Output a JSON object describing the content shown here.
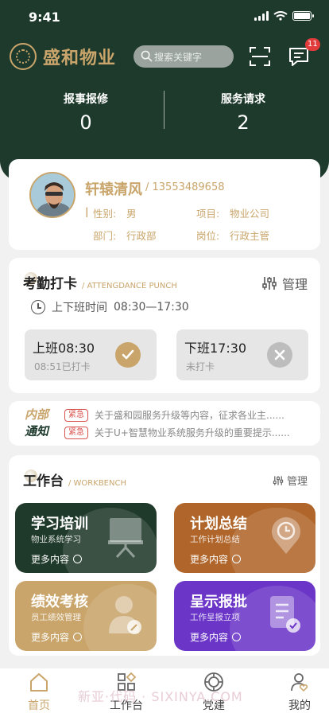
{
  "status_bar": {
    "time": "9:41"
  },
  "header": {
    "brand": "盛和物业",
    "search_placeholder": "搜索关键字",
    "message_badge": "11",
    "stats": [
      {
        "label": "报事报修",
        "value": "0"
      },
      {
        "label": "服务请求",
        "value": "2"
      }
    ]
  },
  "profile": {
    "name": "轩辕清风",
    "phone": "/ 13553489658",
    "gender_label": "性别:",
    "gender": "男",
    "project_label": "项目:",
    "project": "物业公司",
    "dept_label": "部门:",
    "dept": "行政部",
    "post_label": "岗位:",
    "post": "行政主管"
  },
  "attendance": {
    "title": "考勤打卡",
    "subtitle": "/ ATTENGDANCE PUNCH",
    "manage": "管理",
    "worktime_label": "上下班时间",
    "worktime": "08:30—17:30",
    "clock_in": {
      "title": "上班08:30",
      "status": "08:51已打卡"
    },
    "clock_out": {
      "title": "下班17:30",
      "status": "未打卡"
    }
  },
  "notice": {
    "logo_line1": "内部",
    "logo_line2": "通知",
    "items": [
      {
        "tag": "紧急",
        "text": "关于盛和园服务升级等内容，征求各业主......"
      },
      {
        "tag": "紧急",
        "text": "关于U+智慧物业系统服务升级的重要提示......"
      }
    ]
  },
  "workbench": {
    "title": "工作台",
    "subtitle": "/ WORKBENCH",
    "manage": "管理",
    "more": "更多内容",
    "tiles": [
      {
        "title": "学习培训",
        "sub": "物业系统学习",
        "color": "#1f3a2b",
        "icon": "presentation-board-icon"
      },
      {
        "title": "计划总结",
        "sub": "工作计划总结",
        "color": "#b0662b",
        "icon": "clock-pin-icon"
      },
      {
        "title": "绩效考核",
        "sub": "员工绩效管理",
        "color": "#c9a56b",
        "icon": "user-edit-icon"
      },
      {
        "title": "呈示报批",
        "sub": "工作呈报立项",
        "color": "#6b36c8",
        "icon": "document-check-icon"
      }
    ]
  },
  "tabbar": {
    "items": [
      {
        "label": "首页",
        "icon": "home-icon"
      },
      {
        "label": "工作台",
        "icon": "grid-icon"
      },
      {
        "label": "党建",
        "icon": "emblem-icon"
      },
      {
        "label": "我的",
        "icon": "user-heart-icon"
      }
    ]
  },
  "watermark": "新亚·代码 · SIXINYA.COM",
  "colors": {
    "primary": "#1e3a2c",
    "accent": "#c9a56b",
    "urgent": "#d9534f"
  }
}
